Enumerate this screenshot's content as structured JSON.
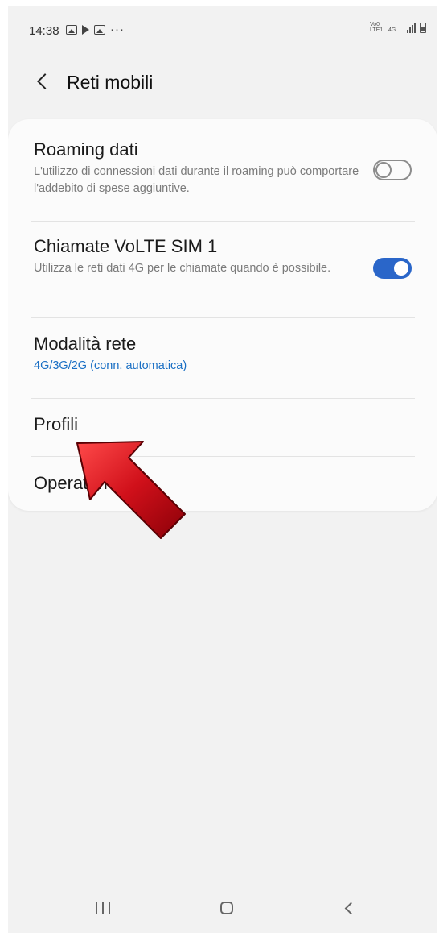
{
  "status_bar": {
    "time": "14:38",
    "left_icons": [
      "image-notification-icon",
      "play-store-icon",
      "gallery-notification-icon",
      "more-notifications-icon"
    ],
    "dots": "···",
    "right_icons": [
      "volte-icon",
      "4g-icon",
      "signal-icon",
      "battery-icon"
    ],
    "volte_text": "Vo0 LTE1",
    "lte_text": "4G"
  },
  "header": {
    "title": "Reti mobili"
  },
  "settings": {
    "roaming": {
      "title": "Roaming dati",
      "subtitle": "L'utilizzo di connessioni dati durante il roaming può comportare l'addebito di spese aggiuntive.",
      "enabled": false
    },
    "volte": {
      "title": "Chiamate VoLTE SIM 1",
      "subtitle": "Utilizza le reti dati 4G per le chiamate quando è possibile.",
      "enabled": true
    },
    "network_mode": {
      "title": "Modalità rete",
      "value": "4G/3G/2G (conn. automatica)"
    },
    "profiles": {
      "title": "Profili"
    },
    "operators": {
      "title": "Operatori rete"
    }
  },
  "colors": {
    "accent": "#2a66c9",
    "link_blue": "#1a6fc4",
    "annotation_arrow": "#d0101a"
  }
}
